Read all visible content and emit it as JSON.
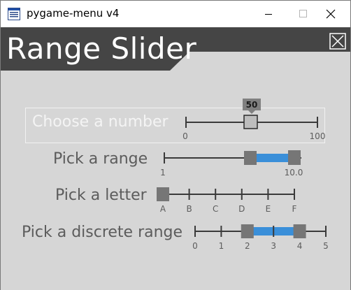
{
  "window": {
    "title": "pygame-menu v4",
    "icon": "pygame-window-icon",
    "controls": {
      "minimize": "minimize-icon",
      "maximize": "maximize-icon",
      "close": "close-icon"
    }
  },
  "menu": {
    "title": "Range Slider",
    "close_icon": "close-x-icon",
    "colors": {
      "background": "#d6d6d6",
      "title_bar": "#454545",
      "accent": "#3a8fd9",
      "handle": "#767676"
    }
  },
  "widgets": [
    {
      "label": "Choose a number",
      "selected": true,
      "value": 50,
      "value_label": "50",
      "range_values": [
        "0",
        "100"
      ]
    },
    {
      "label": "Pick a range",
      "selected": false,
      "values": [
        1,
        10
      ],
      "value_labels": [
        "1",
        "10.0"
      ],
      "selected_range": [
        6,
        9
      ]
    },
    {
      "label": "Pick a letter",
      "selected": false,
      "value": "A",
      "tick_labels": [
        "A",
        "B",
        "C",
        "D",
        "E",
        "F"
      ]
    },
    {
      "label": "Pick a discrete range",
      "selected": false,
      "selected_range": [
        2,
        4
      ],
      "tick_labels": [
        "0",
        "1",
        "2",
        "3",
        "4",
        "5"
      ]
    }
  ]
}
